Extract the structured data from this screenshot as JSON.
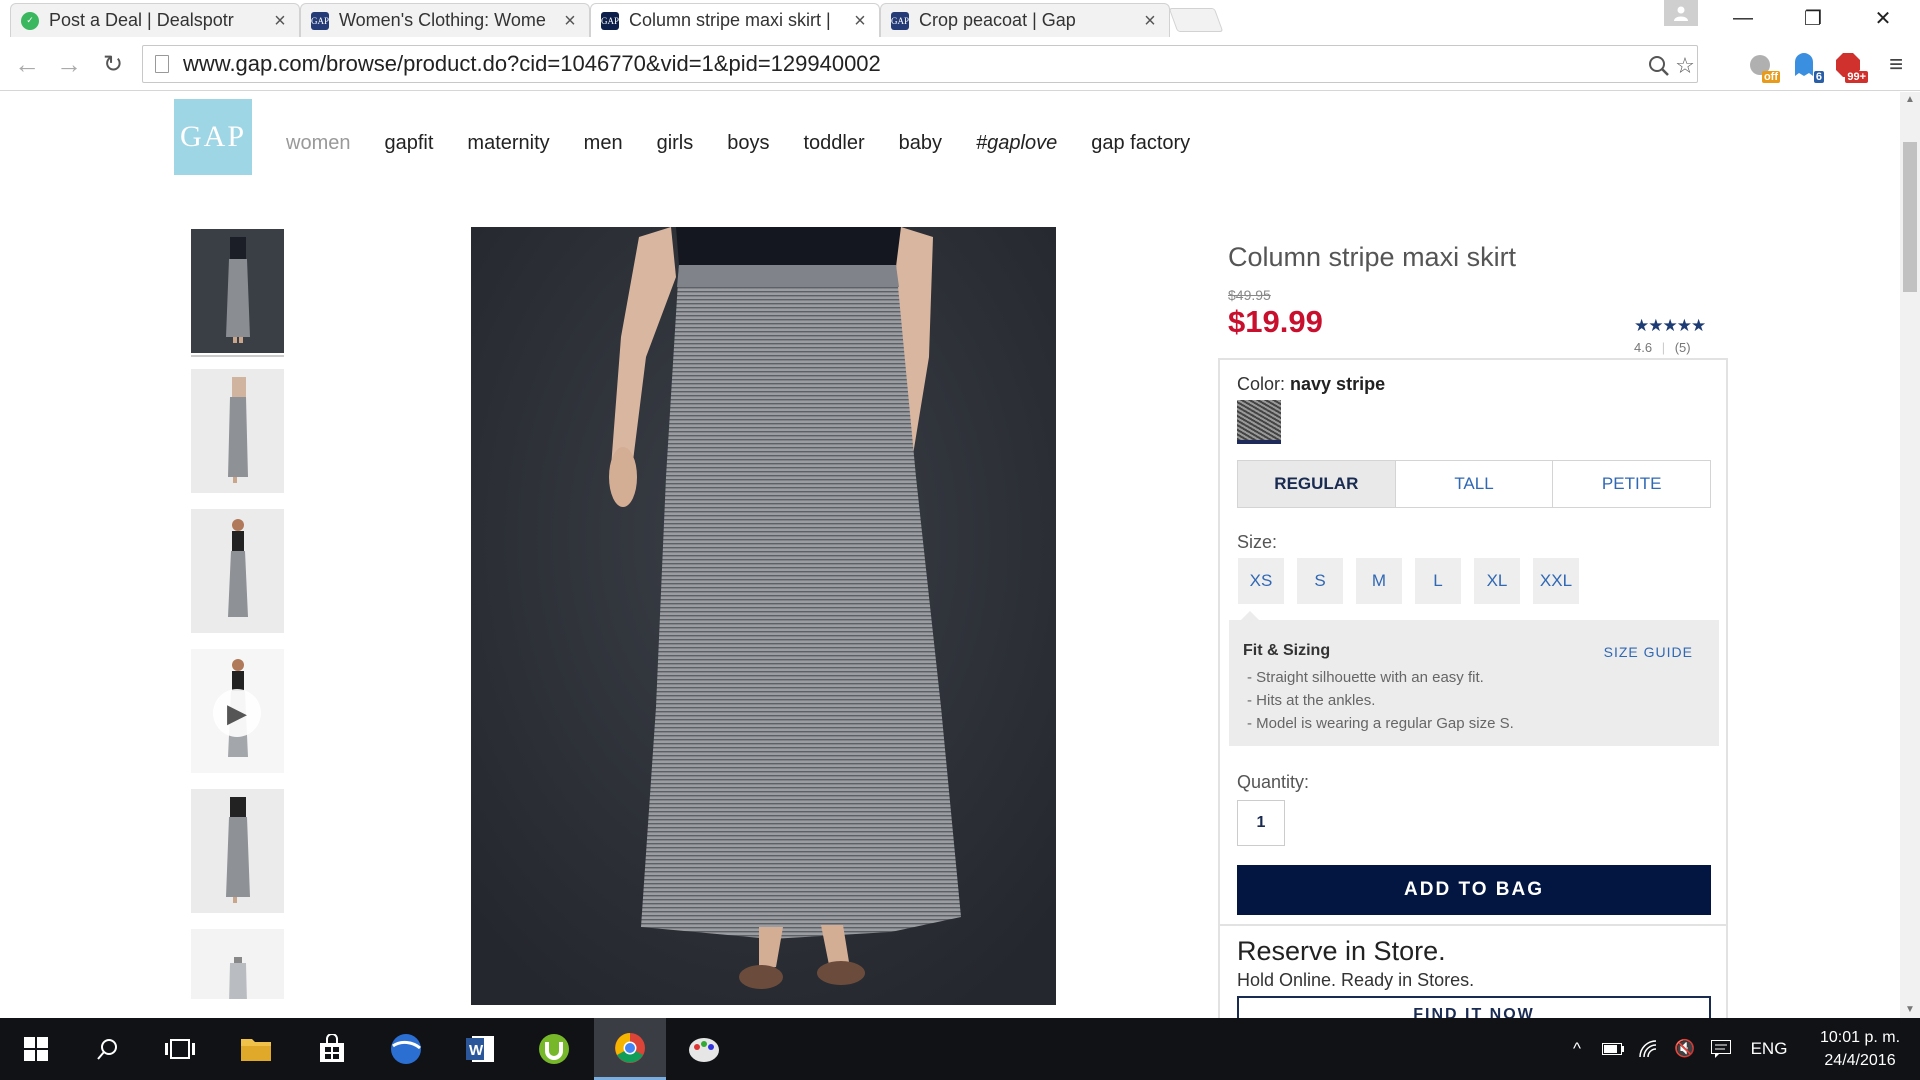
{
  "browser": {
    "tabs": [
      {
        "title": "Post a Deal | Dealspotr",
        "favicon_color": "#3bb75f",
        "active": false
      },
      {
        "title": "Women's Clothing: Wome",
        "favicon_color": "#243b78",
        "active": false
      },
      {
        "title": "Column stripe maxi skirt |",
        "favicon_color": "#0b1f4a",
        "active": true
      },
      {
        "title": "Crop peacoat | Gap",
        "favicon_color": "#243b78",
        "active": false
      }
    ],
    "url": "www.gap.com/browse/product.do?cid=1046770&vid=1&pid=129940002",
    "extensions": [
      {
        "name": "honey-extension-icon",
        "badge": "off",
        "badge_color": "#e89b1a"
      },
      {
        "name": "ghostery-extension-icon",
        "badge": "6",
        "badge_color": "#2a5fa8"
      },
      {
        "name": "adblock-extension-icon",
        "badge": "99+",
        "badge_color": "#d0312d"
      }
    ]
  },
  "site": {
    "logo_text": "GAP",
    "nav": [
      "women",
      "gapfit",
      "maternity",
      "men",
      "girls",
      "boys",
      "toddler",
      "baby",
      "#gaplove",
      "gap factory"
    ]
  },
  "product": {
    "title": "Column stripe maxi skirt",
    "old_price": "$49.95",
    "price": "$19.99",
    "stars": "★★★★★",
    "rating": "4.6",
    "reviews": "(5)",
    "color_label": "Color:",
    "color_value": "navy stripe",
    "fits": [
      "REGULAR",
      "TALL",
      "PETITE"
    ],
    "selected_fit": "REGULAR",
    "size_label": "Size:",
    "sizes": [
      "XS",
      "S",
      "M",
      "L",
      "XL",
      "XXL"
    ],
    "fit_heading": "Fit & Sizing",
    "size_guide": "SIZE GUIDE",
    "fit_notes": [
      "- Straight silhouette with an easy fit.",
      "- Hits at the ankles.",
      "- Model is wearing a regular Gap size S."
    ],
    "quantity_label": "Quantity:",
    "quantity": "1",
    "add_to_bag": "ADD TO BAG",
    "reserve_title": "Reserve in Store.",
    "reserve_subtitle": "Hold Online. Ready in Stores.",
    "find_it_now": "FIND IT NOW"
  },
  "taskbar": {
    "language": "ENG",
    "time": "10:01 p. m.",
    "date": "24/4/2016"
  },
  "colors": {
    "sale_red": "#c8102e",
    "navy": "#031642",
    "link_blue": "#3068b4",
    "gap_logo": "#9fd6e6"
  }
}
